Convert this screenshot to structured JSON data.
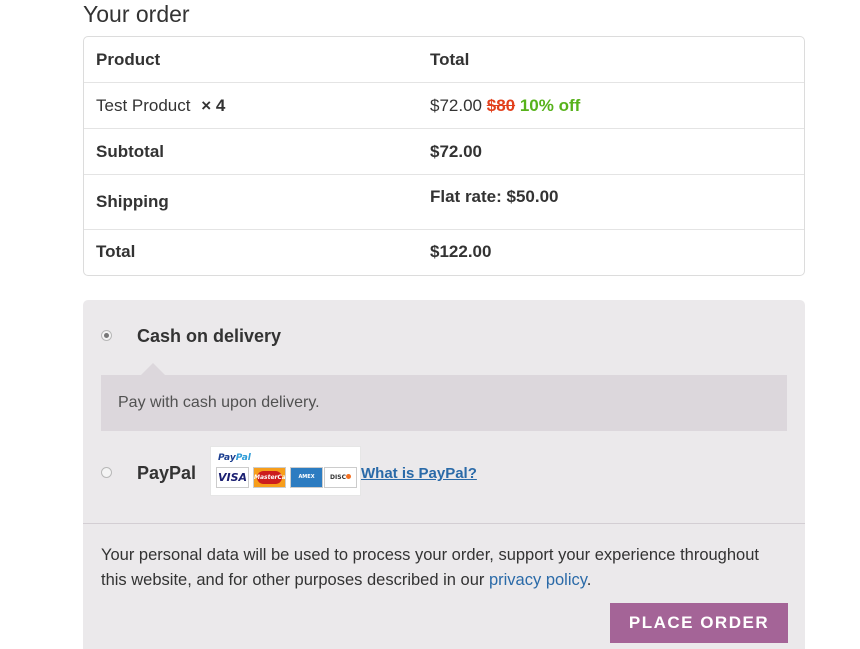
{
  "heading": "Your order",
  "table": {
    "header": {
      "product": "Product",
      "total": "Total"
    },
    "item": {
      "name": "Test Product",
      "qty": "× 4",
      "price": "$72.00",
      "old_price": "$80",
      "discount": "10% off"
    },
    "subtotal": {
      "label": "Subtotal",
      "value": "$72.00"
    },
    "shipping": {
      "label": "Shipping",
      "value": "Flat rate: $50.00"
    },
    "total": {
      "label": "Total",
      "value": "$122.00"
    }
  },
  "payment": {
    "methods": [
      {
        "label": "Cash on delivery",
        "selected": true,
        "description": "Pay with cash upon delivery."
      },
      {
        "label": "PayPal",
        "selected": false,
        "link": "What is PayPal?"
      }
    ],
    "paypal_logo": {
      "brand": "PayPal",
      "cards": [
        "VISA",
        "MasterCard",
        "AMEX",
        "DISCOVER"
      ]
    },
    "privacy": {
      "text": "Your personal data will be used to process your order, support your experience throughout this website, and for other purposes described in our ",
      "link": "privacy policy",
      "end": "."
    },
    "place_order": "PLACE ORDER"
  },
  "colors": {
    "button": "#a46497",
    "strike": "#e2401c",
    "discount": "#57b21b",
    "link": "#2a6aa8"
  }
}
